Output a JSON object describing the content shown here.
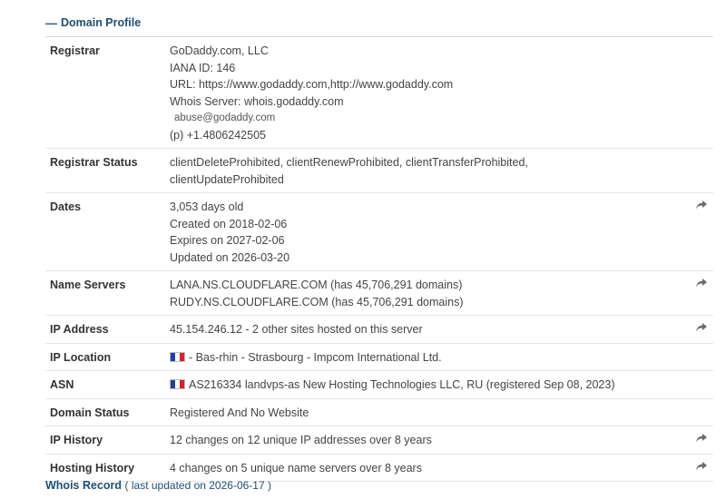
{
  "section": {
    "title": "Domain Profile",
    "collapse_icon": "minus-icon"
  },
  "rows": {
    "registrar": {
      "label": "Registrar",
      "lines": [
        "GoDaddy.com, LLC",
        "IANA ID: 146",
        "URL: https://www.godaddy.com,http://www.godaddy.com",
        "Whois Server: whois.godaddy.com",
        "abuse@godaddy.com",
        "(p) +1.4806242505"
      ]
    },
    "registrar_status": {
      "label": "Registrar Status",
      "lines": [
        "clientDeleteProhibited, clientRenewProhibited, clientTransferProhibited,",
        "clientUpdateProhibited"
      ]
    },
    "dates": {
      "label": "Dates",
      "lines": [
        "3,053 days old",
        "Created on 2018-02-06",
        "Expires on 2027-02-06",
        "Updated on 2026-03-20"
      ]
    },
    "name_servers": {
      "label": "Name Servers",
      "lines": [
        "LANA.NS.CLOUDFLARE.COM (has 45,706,291 domains)",
        "RUDY.NS.CLOUDFLARE.COM (has 45,706,291 domains)"
      ]
    },
    "ip_address": {
      "label": "IP Address",
      "value": "45.154.246.12 - 2 other sites hosted on this server"
    },
    "ip_location": {
      "label": "IP Location",
      "value": "- Bas-rhin - Strasbourg - Impcom International Ltd."
    },
    "asn": {
      "label": "ASN",
      "value": "AS216334 landvps-as New Hosting Technologies LLC, RU (registered Sep 08, 2023)"
    },
    "domain_status": {
      "label": "Domain Status",
      "value": "Registered And No Website"
    },
    "ip_history": {
      "label": "IP History",
      "value": "12 changes on 12 unique IP addresses over 8 years"
    },
    "hosting_history": {
      "label": "Hosting History",
      "value": "4 changes on 5 unique name servers over 8 years"
    }
  },
  "icons": {
    "share": "share-arrow-icon",
    "flag": "france-flag-icon"
  },
  "whois": {
    "title": "Whois Record",
    "note": "( last updated on 2026-06-17 )"
  },
  "colors": {
    "accent": "#1d4e74",
    "border": "#e3e6e9"
  }
}
